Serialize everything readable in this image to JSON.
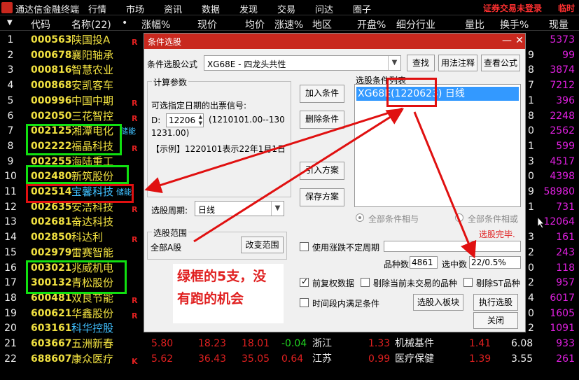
{
  "app": {
    "title": "通达信金融终端"
  },
  "menu": [
    "行情",
    "市场",
    "资讯",
    "数据",
    "发现",
    "交易",
    "问达",
    "圈子"
  ],
  "status": {
    "login": "证券交易未登录",
    "next": "临时"
  },
  "columns": [
    "代码",
    "名称(22)",
    "•",
    "涨幅%",
    "现价",
    "均价",
    "涨速%",
    "地区",
    "开盘%",
    "细分行业",
    "量比",
    "换手%",
    "现量"
  ],
  "rows": [
    {
      "i": "1",
      "code": "000563",
      "name": "陕国投A",
      "mark": "R",
      "vol": "5373"
    },
    {
      "i": "2",
      "code": "000678",
      "name": "襄阳轴承",
      "mark": "",
      "vol": "99",
      "turn": "9"
    },
    {
      "i": "3",
      "code": "000816",
      "name": "智慧农业",
      "mark": "",
      "vol": "3874",
      "turn": "8"
    },
    {
      "i": "4",
      "code": "000868",
      "name": "安凯客车",
      "mark": "",
      "vol": "7212",
      "turn": "7"
    },
    {
      "i": "5",
      "code": "000996",
      "name": "中国中期",
      "mark": "R",
      "vol": "396",
      "turn": "1"
    },
    {
      "i": "6",
      "code": "002050",
      "name": "三花智控",
      "mark": "R",
      "vol": "2248",
      "turn": "8"
    },
    {
      "i": "7",
      "code": "002125",
      "name": "湘潭电化",
      "mark": "",
      "vol": "2562",
      "turn": "0",
      "tag": "储能"
    },
    {
      "i": "8",
      "code": "002222",
      "name": "福晶科技",
      "mark": "R",
      "vol": "599",
      "turn": "1"
    },
    {
      "i": "9",
      "code": "002255",
      "name": "海陆重工",
      "mark": "",
      "vol": "4517",
      "turn": "3"
    },
    {
      "i": "10",
      "code": "002480",
      "name": "新筑股份",
      "mark": "",
      "vol": "4398",
      "turn": "0"
    },
    {
      "i": "11",
      "code": "002514",
      "name": "宝馨科技",
      "mark": "",
      "vol": "58980",
      "turn": "9",
      "tag": "储能"
    },
    {
      "i": "12",
      "code": "002635",
      "name": "安洁科技",
      "mark": "R",
      "vol": "731",
      "turn": "1"
    },
    {
      "i": "13",
      "code": "002681",
      "name": "奋达科技",
      "mark": "",
      "vol": "12064",
      "turn": ""
    },
    {
      "i": "14",
      "code": "002850",
      "name": "科达利",
      "mark": "R",
      "vol": "161",
      "turn": "3"
    },
    {
      "i": "15",
      "code": "002979",
      "name": "雷赛智能",
      "mark": "",
      "vol": "243",
      "turn": "2"
    },
    {
      "i": "16",
      "code": "003021",
      "name": "兆威机电",
      "mark": "",
      "vol": "118",
      "turn": "0"
    },
    {
      "i": "17",
      "code": "300132",
      "name": "青松股份",
      "mark": "",
      "vol": "957",
      "turn": "2"
    },
    {
      "i": "18",
      "code": "600481",
      "name": "双良节能",
      "mark": "R",
      "vol": "6017",
      "turn": "4"
    },
    {
      "i": "19",
      "code": "600621",
      "name": "华鑫股份",
      "mark": "R",
      "vol": "1605",
      "turn": "0"
    },
    {
      "i": "20",
      "code": "603161",
      "name": "科华控股",
      "mark": "",
      "vol": "1091",
      "turn": "2"
    },
    {
      "i": "21",
      "code": "603667",
      "name": "五洲新春",
      "mark": "",
      "chg": "5.80",
      "price": "18.23",
      "avg": "18.01",
      "spd": "-0.04",
      "region": "浙江",
      "open": "1.33",
      "ind": "机械基件",
      "ratio": "1.41",
      "turn": "6.08",
      "vol": "933"
    },
    {
      "i": "22",
      "code": "688607",
      "name": "康众医疗",
      "mark": "K",
      "chg": "5.62",
      "price": "36.43",
      "avg": "35.05",
      "spd": "0.64",
      "region": "江苏",
      "open": "0.99",
      "ind": "医疗保健",
      "ratio": "1.39",
      "turn": "3.55",
      "vol": "261"
    }
  ],
  "dialog": {
    "title": "条件选股",
    "formula_label": "条件选股公式",
    "formula_value": "XG68E        - 四龙头共性",
    "btn_find": "查找",
    "btn_usage": "用法注释",
    "btn_view": "查看公式",
    "calc_group": "计算参数",
    "calc_hint": "可选指定日期的出票信号:",
    "d_label": "D:",
    "d_value": "12206",
    "d_range": "(1210101.00--130",
    "d_range2": "1231.00)",
    "example": "【示例】1220101表示22年1月1日",
    "btn_add": "加入条件",
    "btn_del": "删除条件",
    "btn_import": "引入方案",
    "btn_save": "保存方案",
    "list_label": "选股条件列表",
    "list_item": "XG68E(1220623) 日线",
    "radio_and": "全部条件相与",
    "radio_or": "全部条件相或",
    "period_label": "选股周期:",
    "period_value": "日线",
    "range_group": "选股范围",
    "range_value": "全部A股",
    "btn_range": "改变范围",
    "done": "选股完毕.",
    "use_uncertain": "使用涨跌不定周期",
    "count_label": "品种数",
    "count_value": "4861",
    "hit_label": "选中数",
    "hit_value": "22/0.5%",
    "fq": "前复权数据",
    "exclude_stop": "剔除当前未交易的品种",
    "exclude_st": "剔除ST品种",
    "time_ok": "时间段内满足条件",
    "btn_to_board": "选股入板块",
    "btn_run": "执行选股",
    "btn_close": "关闭"
  },
  "annotation": {
    "line1": "绿框的5支，没",
    "line2": "有跑的机会"
  },
  "colors": {
    "title_red": "#c8281e",
    "code_yellow": "#f0e040",
    "up_red": "#e02020",
    "vol_magenta": "#e020e0",
    "select_blue": "#3399ff"
  }
}
